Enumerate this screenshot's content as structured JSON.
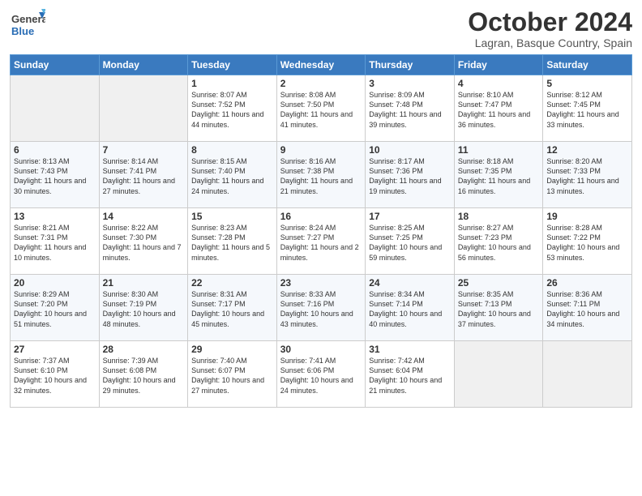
{
  "header": {
    "logo_general": "General",
    "logo_blue": "Blue",
    "month_title": "October 2024",
    "location": "Lagran, Basque Country, Spain"
  },
  "days_of_week": [
    "Sunday",
    "Monday",
    "Tuesday",
    "Wednesday",
    "Thursday",
    "Friday",
    "Saturday"
  ],
  "weeks": [
    [
      {
        "num": "",
        "info": ""
      },
      {
        "num": "",
        "info": ""
      },
      {
        "num": "1",
        "info": "Sunrise: 8:07 AM\nSunset: 7:52 PM\nDaylight: 11 hours and 44 minutes."
      },
      {
        "num": "2",
        "info": "Sunrise: 8:08 AM\nSunset: 7:50 PM\nDaylight: 11 hours and 41 minutes."
      },
      {
        "num": "3",
        "info": "Sunrise: 8:09 AM\nSunset: 7:48 PM\nDaylight: 11 hours and 39 minutes."
      },
      {
        "num": "4",
        "info": "Sunrise: 8:10 AM\nSunset: 7:47 PM\nDaylight: 11 hours and 36 minutes."
      },
      {
        "num": "5",
        "info": "Sunrise: 8:12 AM\nSunset: 7:45 PM\nDaylight: 11 hours and 33 minutes."
      }
    ],
    [
      {
        "num": "6",
        "info": "Sunrise: 8:13 AM\nSunset: 7:43 PM\nDaylight: 11 hours and 30 minutes."
      },
      {
        "num": "7",
        "info": "Sunrise: 8:14 AM\nSunset: 7:41 PM\nDaylight: 11 hours and 27 minutes."
      },
      {
        "num": "8",
        "info": "Sunrise: 8:15 AM\nSunset: 7:40 PM\nDaylight: 11 hours and 24 minutes."
      },
      {
        "num": "9",
        "info": "Sunrise: 8:16 AM\nSunset: 7:38 PM\nDaylight: 11 hours and 21 minutes."
      },
      {
        "num": "10",
        "info": "Sunrise: 8:17 AM\nSunset: 7:36 PM\nDaylight: 11 hours and 19 minutes."
      },
      {
        "num": "11",
        "info": "Sunrise: 8:18 AM\nSunset: 7:35 PM\nDaylight: 11 hours and 16 minutes."
      },
      {
        "num": "12",
        "info": "Sunrise: 8:20 AM\nSunset: 7:33 PM\nDaylight: 11 hours and 13 minutes."
      }
    ],
    [
      {
        "num": "13",
        "info": "Sunrise: 8:21 AM\nSunset: 7:31 PM\nDaylight: 11 hours and 10 minutes."
      },
      {
        "num": "14",
        "info": "Sunrise: 8:22 AM\nSunset: 7:30 PM\nDaylight: 11 hours and 7 minutes."
      },
      {
        "num": "15",
        "info": "Sunrise: 8:23 AM\nSunset: 7:28 PM\nDaylight: 11 hours and 5 minutes."
      },
      {
        "num": "16",
        "info": "Sunrise: 8:24 AM\nSunset: 7:27 PM\nDaylight: 11 hours and 2 minutes."
      },
      {
        "num": "17",
        "info": "Sunrise: 8:25 AM\nSunset: 7:25 PM\nDaylight: 10 hours and 59 minutes."
      },
      {
        "num": "18",
        "info": "Sunrise: 8:27 AM\nSunset: 7:23 PM\nDaylight: 10 hours and 56 minutes."
      },
      {
        "num": "19",
        "info": "Sunrise: 8:28 AM\nSunset: 7:22 PM\nDaylight: 10 hours and 53 minutes."
      }
    ],
    [
      {
        "num": "20",
        "info": "Sunrise: 8:29 AM\nSunset: 7:20 PM\nDaylight: 10 hours and 51 minutes."
      },
      {
        "num": "21",
        "info": "Sunrise: 8:30 AM\nSunset: 7:19 PM\nDaylight: 10 hours and 48 minutes."
      },
      {
        "num": "22",
        "info": "Sunrise: 8:31 AM\nSunset: 7:17 PM\nDaylight: 10 hours and 45 minutes."
      },
      {
        "num": "23",
        "info": "Sunrise: 8:33 AM\nSunset: 7:16 PM\nDaylight: 10 hours and 43 minutes."
      },
      {
        "num": "24",
        "info": "Sunrise: 8:34 AM\nSunset: 7:14 PM\nDaylight: 10 hours and 40 minutes."
      },
      {
        "num": "25",
        "info": "Sunrise: 8:35 AM\nSunset: 7:13 PM\nDaylight: 10 hours and 37 minutes."
      },
      {
        "num": "26",
        "info": "Sunrise: 8:36 AM\nSunset: 7:11 PM\nDaylight: 10 hours and 34 minutes."
      }
    ],
    [
      {
        "num": "27",
        "info": "Sunrise: 7:37 AM\nSunset: 6:10 PM\nDaylight: 10 hours and 32 minutes."
      },
      {
        "num": "28",
        "info": "Sunrise: 7:39 AM\nSunset: 6:08 PM\nDaylight: 10 hours and 29 minutes."
      },
      {
        "num": "29",
        "info": "Sunrise: 7:40 AM\nSunset: 6:07 PM\nDaylight: 10 hours and 27 minutes."
      },
      {
        "num": "30",
        "info": "Sunrise: 7:41 AM\nSunset: 6:06 PM\nDaylight: 10 hours and 24 minutes."
      },
      {
        "num": "31",
        "info": "Sunrise: 7:42 AM\nSunset: 6:04 PM\nDaylight: 10 hours and 21 minutes."
      },
      {
        "num": "",
        "info": ""
      },
      {
        "num": "",
        "info": ""
      }
    ]
  ]
}
